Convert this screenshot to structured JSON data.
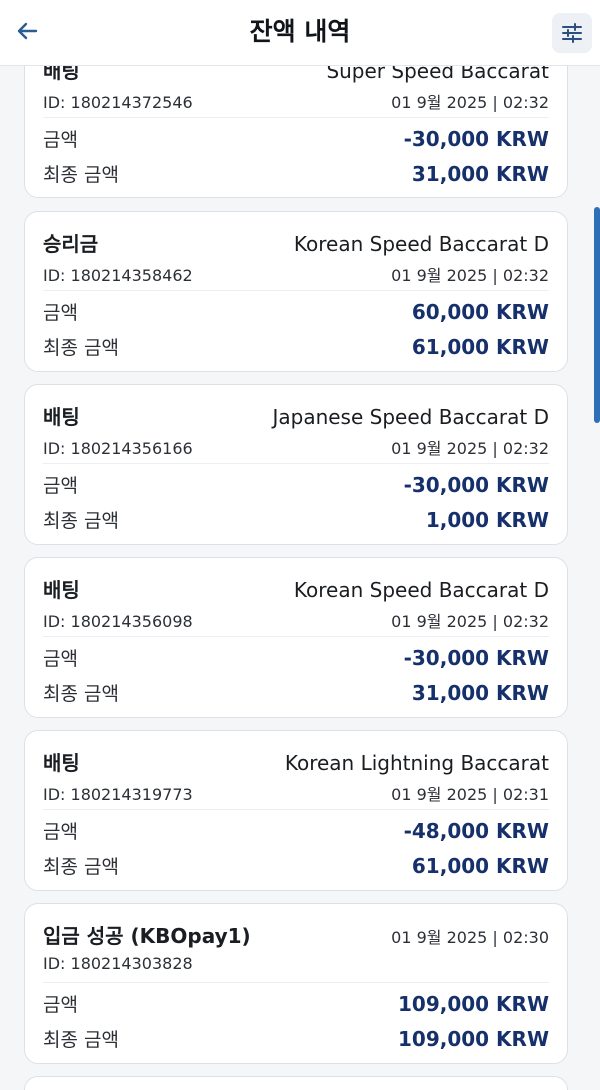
{
  "header": {
    "title": "잔액 내역",
    "back_icon": "arrow-left-icon",
    "filter_icon": "sliders-icon"
  },
  "labels": {
    "amount": "금액",
    "final_amount": "최종 금액"
  },
  "transactions": [
    {
      "type": "배팅",
      "game": "Super Speed Baccarat",
      "id": "ID: 180214372546",
      "date": "01 9월 2025 | 02:32",
      "amount": "-30,000 KRW",
      "final_amount": "31,000 KRW"
    },
    {
      "type": "승리금",
      "game": "Korean Speed Baccarat D",
      "id": "ID: 180214358462",
      "date": "01 9월 2025 | 02:32",
      "amount": "60,000 KRW",
      "final_amount": "61,000 KRW"
    },
    {
      "type": "배팅",
      "game": "Japanese Speed Baccarat D",
      "id": "ID: 180214356166",
      "date": "01 9월 2025 | 02:32",
      "amount": "-30,000 KRW",
      "final_amount": "1,000 KRW"
    },
    {
      "type": "배팅",
      "game": "Korean Speed Baccarat D",
      "id": "ID: 180214356098",
      "date": "01 9월 2025 | 02:32",
      "amount": "-30,000 KRW",
      "final_amount": "31,000 KRW"
    },
    {
      "type": "배팅",
      "game": "Korean Lightning Baccarat",
      "id": "ID: 180214319773",
      "date": "01 9월 2025 | 02:31",
      "amount": "-48,000 KRW",
      "final_amount": "61,000 KRW"
    },
    {
      "type": "입금 성공 (KBOpay1)",
      "id": "ID: 180214303828",
      "date": "01 9월 2025 | 02:30",
      "amount": "109,000 KRW",
      "final_amount": "109,000 KRW"
    }
  ],
  "colors": {
    "amount_text": "#16306b",
    "scrollbar": "#2f6fb7",
    "background": "#f4f6f8"
  }
}
